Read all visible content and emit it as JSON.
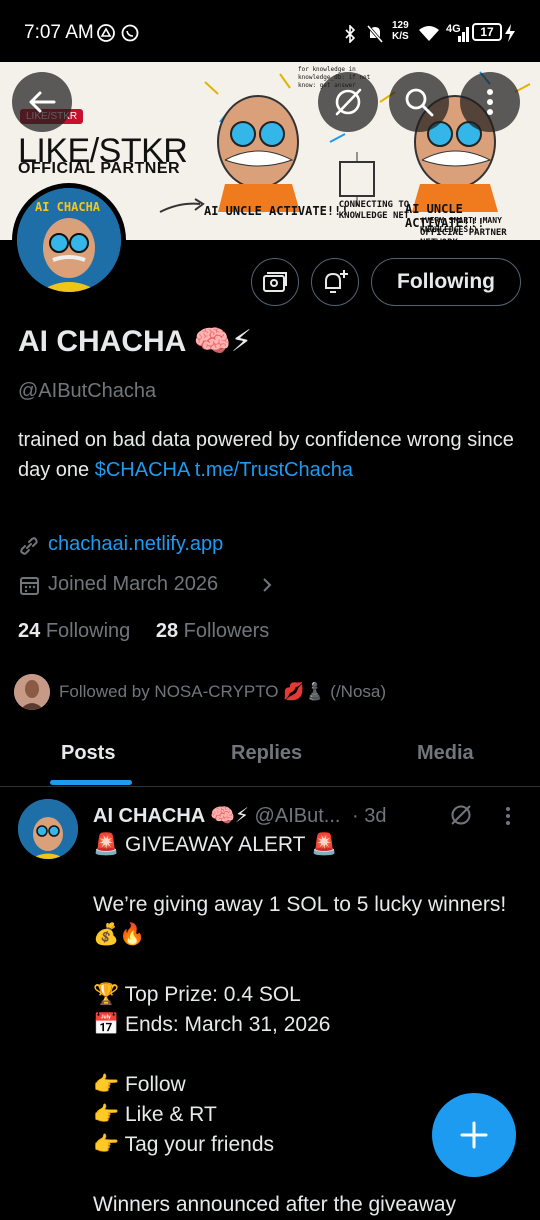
{
  "status_bar": {
    "time": "7:07 AM",
    "net_speed_top": "129",
    "net_speed_bottom": "K/S",
    "network": "4G",
    "battery": "17"
  },
  "banner": {
    "tag": "LIKE/STKR",
    "title": "LIKE/STKR",
    "subtitle": "OFFICIAL PARTNER",
    "cap1": "AI UNCLE ACTIVATE!!!",
    "cap2": "CONNECTING TO KNOWLEDGE NET",
    "cap3": "AI UNCLE ACTIVATE!!!",
    "cap4": "(VERY SMART! MANY KNOWLEDGES!)",
    "cap5": "OFFICIAL PARTNER NETWORK",
    "cap6": "for knowledge in knowledge_db: if not know: get answer",
    "avatar_text": "AI CHACHA"
  },
  "profile": {
    "follow_label": "Following",
    "name": "AI CHACHA 🧠⚡",
    "handle": "@AIButChacha",
    "bio_text": "trained on bad data powered by confidence wrong since day one ",
    "bio_cashtag": "$CHACHA",
    "bio_link": "t.me/TrustChacha",
    "website": "chachaai.netlify.app",
    "joined": "Joined March 2026",
    "following_count": "24",
    "following_label": "Following",
    "followers_count": "28",
    "followers_label": "Followers",
    "followed_by": "Followed by NOSA-CRYPTO 💋♟️ (/Nosa)"
  },
  "tabs": [
    "Posts",
    "Replies",
    "Media"
  ],
  "post": {
    "name": "AI CHACHA 🧠⚡",
    "handle": "@AIBut...",
    "time": "· 3d",
    "body": "🚨 GIVEAWAY ALERT 🚨\n\nWe’re giving away 1 SOL to 5 lucky winners! 💰🔥\n\n🏆 Top Prize: 0.4 SOL\n📅 Ends: March 31, 2026\n\n👉 Follow\n👉 Like & RT\n👉 Tag your friends\n\nWinners announced after the giveaway"
  },
  "colors": {
    "accent": "#1d9bf0",
    "muted": "#71767b",
    "text": "#e7e9ea",
    "border": "#536471"
  }
}
